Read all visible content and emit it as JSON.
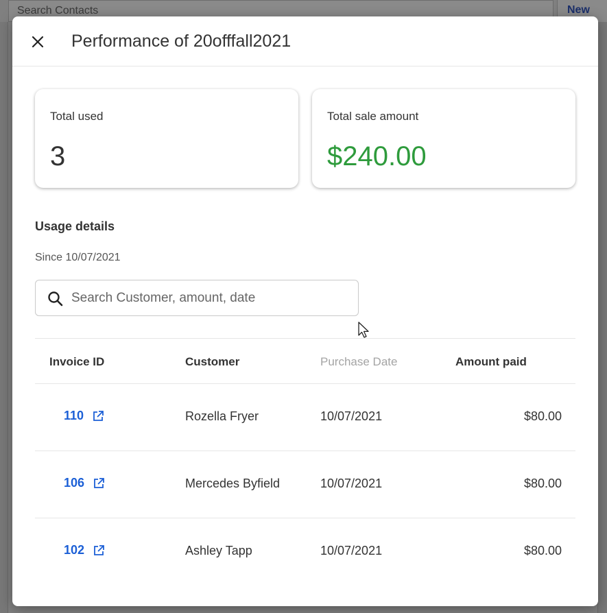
{
  "background": {
    "search_placeholder": "Search Contacts",
    "new_button": "New"
  },
  "modal": {
    "title": "Performance of 20offfall2021",
    "close_icon": "close-icon"
  },
  "stats": {
    "total_used_label": "Total used",
    "total_used_value": "3",
    "total_sale_label": "Total sale amount",
    "total_sale_value": "$240.00",
    "sale_color": "#2e9b3c"
  },
  "usage": {
    "title": "Usage details",
    "since": "Since 10/07/2021",
    "search_placeholder": "Search Customer, amount, date"
  },
  "table": {
    "headers": {
      "invoice_id": "Invoice ID",
      "customer": "Customer",
      "purchase_date": "Purchase Date",
      "amount_paid": "Amount paid"
    },
    "rows": [
      {
        "invoice": "110",
        "customer": "Rozella Fryer",
        "date": "10/07/2021",
        "amount": "$80.00"
      },
      {
        "invoice": "106",
        "customer": "Mercedes Byfield",
        "date": "10/07/2021",
        "amount": "$80.00"
      },
      {
        "invoice": "102",
        "customer": "Ashley Tapp",
        "date": "10/07/2021",
        "amount": "$80.00"
      }
    ]
  },
  "colors": {
    "link": "#1b5fd6",
    "overlay": "#808080"
  }
}
